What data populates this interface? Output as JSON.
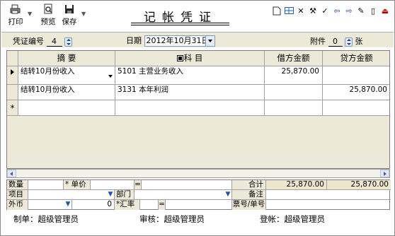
{
  "toolbar": {
    "buttons": [
      {
        "label": "打印",
        "icon": "print-icon"
      },
      {
        "label": "预览",
        "icon": "preview-icon"
      },
      {
        "label": "保存",
        "icon": "save-icon"
      }
    ],
    "title": "记帐凭证",
    "right_icons": [
      "new-doc-icon",
      "insert-row-icon",
      "delete-icon",
      "tools-icon",
      "check-icon",
      "prev-icon",
      "next-icon",
      "pen-icon",
      "attach-icon",
      "exit-icon"
    ]
  },
  "header": {
    "voucher_no_label": "凭证编号",
    "voucher_no": "4",
    "date_label": "日期",
    "date_value": "2012年10月31日",
    "attach_label": "附件",
    "attach_count": "0",
    "attach_unit": "张"
  },
  "grid": {
    "columns": [
      "摘    要",
      "科    目",
      "借方金额",
      "贷方金额"
    ],
    "rows": [
      {
        "summary": "结转10月份收入",
        "account": "5101 主营业务收入",
        "debit": "25,870.00",
        "credit": ""
      },
      {
        "summary": "结转10月份收入",
        "account": "3131 本年利润",
        "debit": "",
        "credit": "25,870.00"
      },
      {
        "summary": "",
        "account": "",
        "debit": "",
        "credit": ""
      }
    ],
    "new_row_marker": "*"
  },
  "info": {
    "qty_label": "数量",
    "price_label": "* 单价",
    "eq": "=",
    "total_label": "合计",
    "total_debit": "25,870.00",
    "total_credit": "25,870.00",
    "project_label": "项目",
    "dept_label": "部门",
    "remark_label": "备注",
    "fx_label": "外币",
    "fx_amount": "0",
    "rate_label": "*汇率",
    "eq2": "=",
    "ticket_label": "票号/单号"
  },
  "footer": {
    "maker": "制单：超级管理员",
    "auditor": "审核：超级管理员",
    "poster": "登帐：超级管理员"
  }
}
